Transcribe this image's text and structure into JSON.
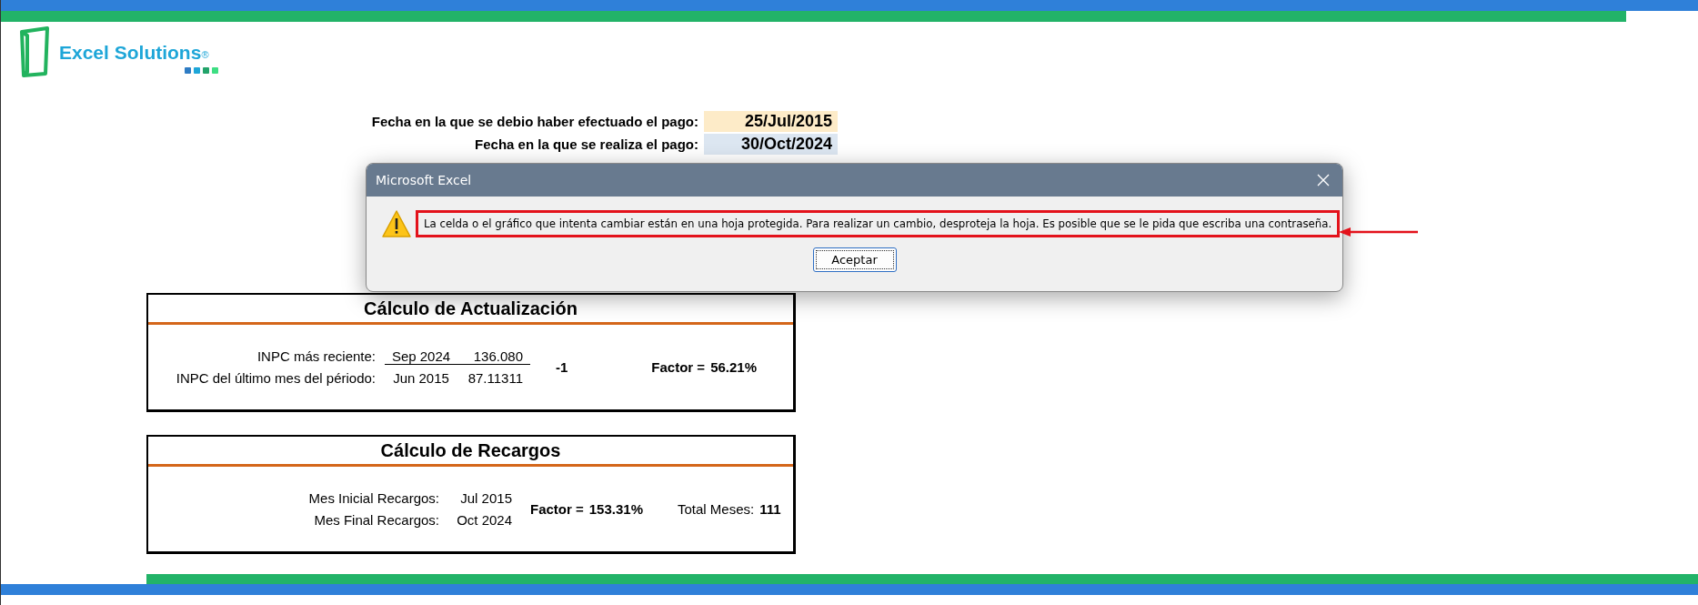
{
  "logo": {
    "name": "Excel Solutions",
    "mark": "®"
  },
  "dates": [
    {
      "label": "Fecha en la que se debio haber efectuado el pago:",
      "value": "25/Jul/2015",
      "color": "#fdebc8"
    },
    {
      "label": "Fecha en la que se realiza el pago:",
      "value": "30/Oct/2024",
      "color": "#dce6f1"
    }
  ],
  "actualizacion": {
    "title": "Cálculo de Actualización",
    "rows": [
      {
        "label": "INPC más reciente:",
        "month": "Sep 2024",
        "value": "136.080"
      },
      {
        "label": "INPC del último mes del périodo:",
        "month": "Jun 2015",
        "value": "87.11311"
      }
    ],
    "result": "-1",
    "factor_label": "Factor =",
    "factor_value": "56.21%"
  },
  "recargos": {
    "title": "Cálculo de Recargos",
    "rows": [
      {
        "label": "Mes Inicial Recargos:",
        "month": "Jul 2015"
      },
      {
        "label": "Mes Final Recargos:",
        "month": "Oct 2024"
      }
    ],
    "factor_label": "Factor =",
    "factor_value": "153.31%",
    "total_label": "Total Meses:",
    "total_value": "111"
  },
  "dialog": {
    "title": "Microsoft Excel",
    "message": "La celda o el gráfico que intenta cambiar están en una hoja protegida. Para realizar un cambio, desproteja la hoja. Es posible que se le pida que escriba una contraseña.",
    "button": "Aceptar"
  }
}
